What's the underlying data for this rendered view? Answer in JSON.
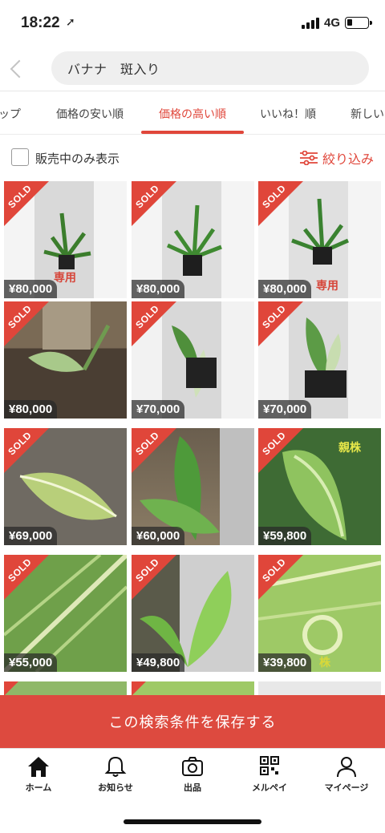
{
  "status_bar": {
    "time": "18:22",
    "network": "4G"
  },
  "search": {
    "query": "バナナ　斑入り"
  },
  "tabs": [
    {
      "label": "ップ",
      "active": false
    },
    {
      "label": "価格の安い順",
      "active": false
    },
    {
      "label": "価格の高い順",
      "active": true
    },
    {
      "label": "いいね！順",
      "active": false
    },
    {
      "label": "新しい",
      "active": false
    }
  ],
  "filter": {
    "on_sale_label": "販売中のみ表示",
    "narrow_label": "絞り込み"
  },
  "items": [
    {
      "price": "¥80,000",
      "badge": "SOLD",
      "note": "専用"
    },
    {
      "price": "¥80,000",
      "badge": "SOLD",
      "note": ""
    },
    {
      "price": "¥80,000",
      "badge": "SOLD",
      "note": "専用"
    },
    {
      "price": "¥80,000",
      "badge": "SOLD",
      "note": ""
    },
    {
      "price": "¥70,000",
      "badge": "SOLD",
      "note": ""
    },
    {
      "price": "¥70,000",
      "badge": "SOLD",
      "note": ""
    },
    {
      "price": "¥69,000",
      "badge": "SOLD",
      "note": ""
    },
    {
      "price": "¥60,000",
      "badge": "SOLD",
      "note": ""
    },
    {
      "price": "¥59,800",
      "badge": "SOLD",
      "note": "親株"
    },
    {
      "price": "¥55,000",
      "badge": "SOLD",
      "note": ""
    },
    {
      "price": "¥49,800",
      "badge": "SOLD",
      "note": ""
    },
    {
      "price": "¥39,800",
      "badge": "SOLD",
      "note": "株"
    }
  ],
  "save_button": "この検索条件を保存する",
  "nav": [
    {
      "label": "ホーム",
      "icon": "home-icon"
    },
    {
      "label": "お知らせ",
      "icon": "bell-icon"
    },
    {
      "label": "出品",
      "icon": "camera-icon"
    },
    {
      "label": "メルペイ",
      "icon": "qr-code-icon"
    },
    {
      "label": "マイページ",
      "icon": "person-icon"
    }
  ],
  "colors": {
    "accent": "#e0463a",
    "save_bar": "#dd4a3f"
  }
}
